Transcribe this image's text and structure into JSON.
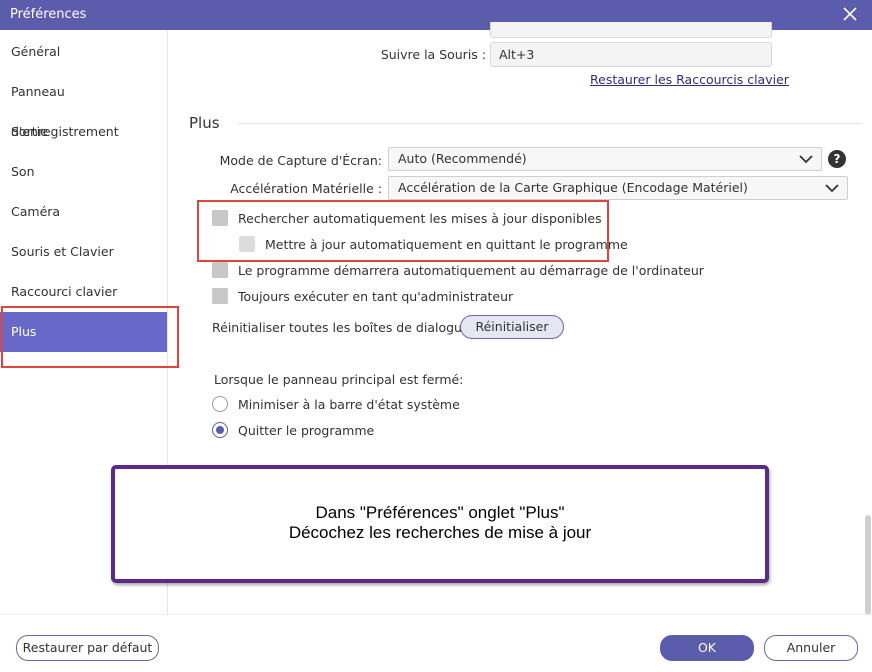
{
  "window": {
    "title": "Préférences",
    "close_icon": "close-icon"
  },
  "sidebar": {
    "items": [
      {
        "label": "Général"
      },
      {
        "label": "Panneau d'enregistrement"
      },
      {
        "label": "Sortie"
      },
      {
        "label": "Son"
      },
      {
        "label": "Caméra"
      },
      {
        "label": "Souris et Clavier"
      },
      {
        "label": "Raccourci clavier"
      },
      {
        "label": "Plus",
        "active": true
      }
    ]
  },
  "shortcuts": {
    "follow_mouse_label": "Suivre la Souris :",
    "follow_mouse_value": "Alt+3",
    "restore_link": "Restaurer les Raccourcis clavier"
  },
  "plus": {
    "title": "Plus",
    "capture_mode_label": "Mode de Capture d'Écran:",
    "capture_mode_value": "Auto (Recommendé)",
    "hw_accel_label": "Accélération Matérielle :",
    "hw_accel_value": "Accélération de la Carte Graphique (Encodage Matériel)",
    "options": [
      {
        "label": "Rechercher automatiquement les mises à jour disponibles",
        "checked": false
      },
      {
        "label": "Mettre à jour automatiquement en quittant le programme",
        "checked": false,
        "disabled": true
      },
      {
        "label": "Le programme démarrera automatiquement au démarrage de l'ordinateur",
        "checked": false
      },
      {
        "label": "Toujours exécuter en tant qu'administrateur",
        "checked": false
      }
    ],
    "reset_dialogs_label": "Réinitialiser toutes les boîtes de dialogue:",
    "reset_button": "Réinitialiser",
    "on_close_label": "Lorsque le panneau principal est fermé:",
    "on_close_options": [
      {
        "label": "Minimiser à la barre d'état système",
        "selected": false
      },
      {
        "label": "Quitter le programme",
        "selected": true
      }
    ]
  },
  "callout": {
    "line1": "Dans \"Préférences\" onglet \"Plus\"",
    "line2": "Décochez les recherches de mise à jour"
  },
  "footer": {
    "restore_default": "Restaurer par défaut",
    "ok": "OK",
    "cancel": "Annuler"
  },
  "colors": {
    "accent": "#5c5cad",
    "sidebar_active": "#6768c8",
    "highlight_red": "#e0453d",
    "callout_border": "#5b2a86"
  }
}
